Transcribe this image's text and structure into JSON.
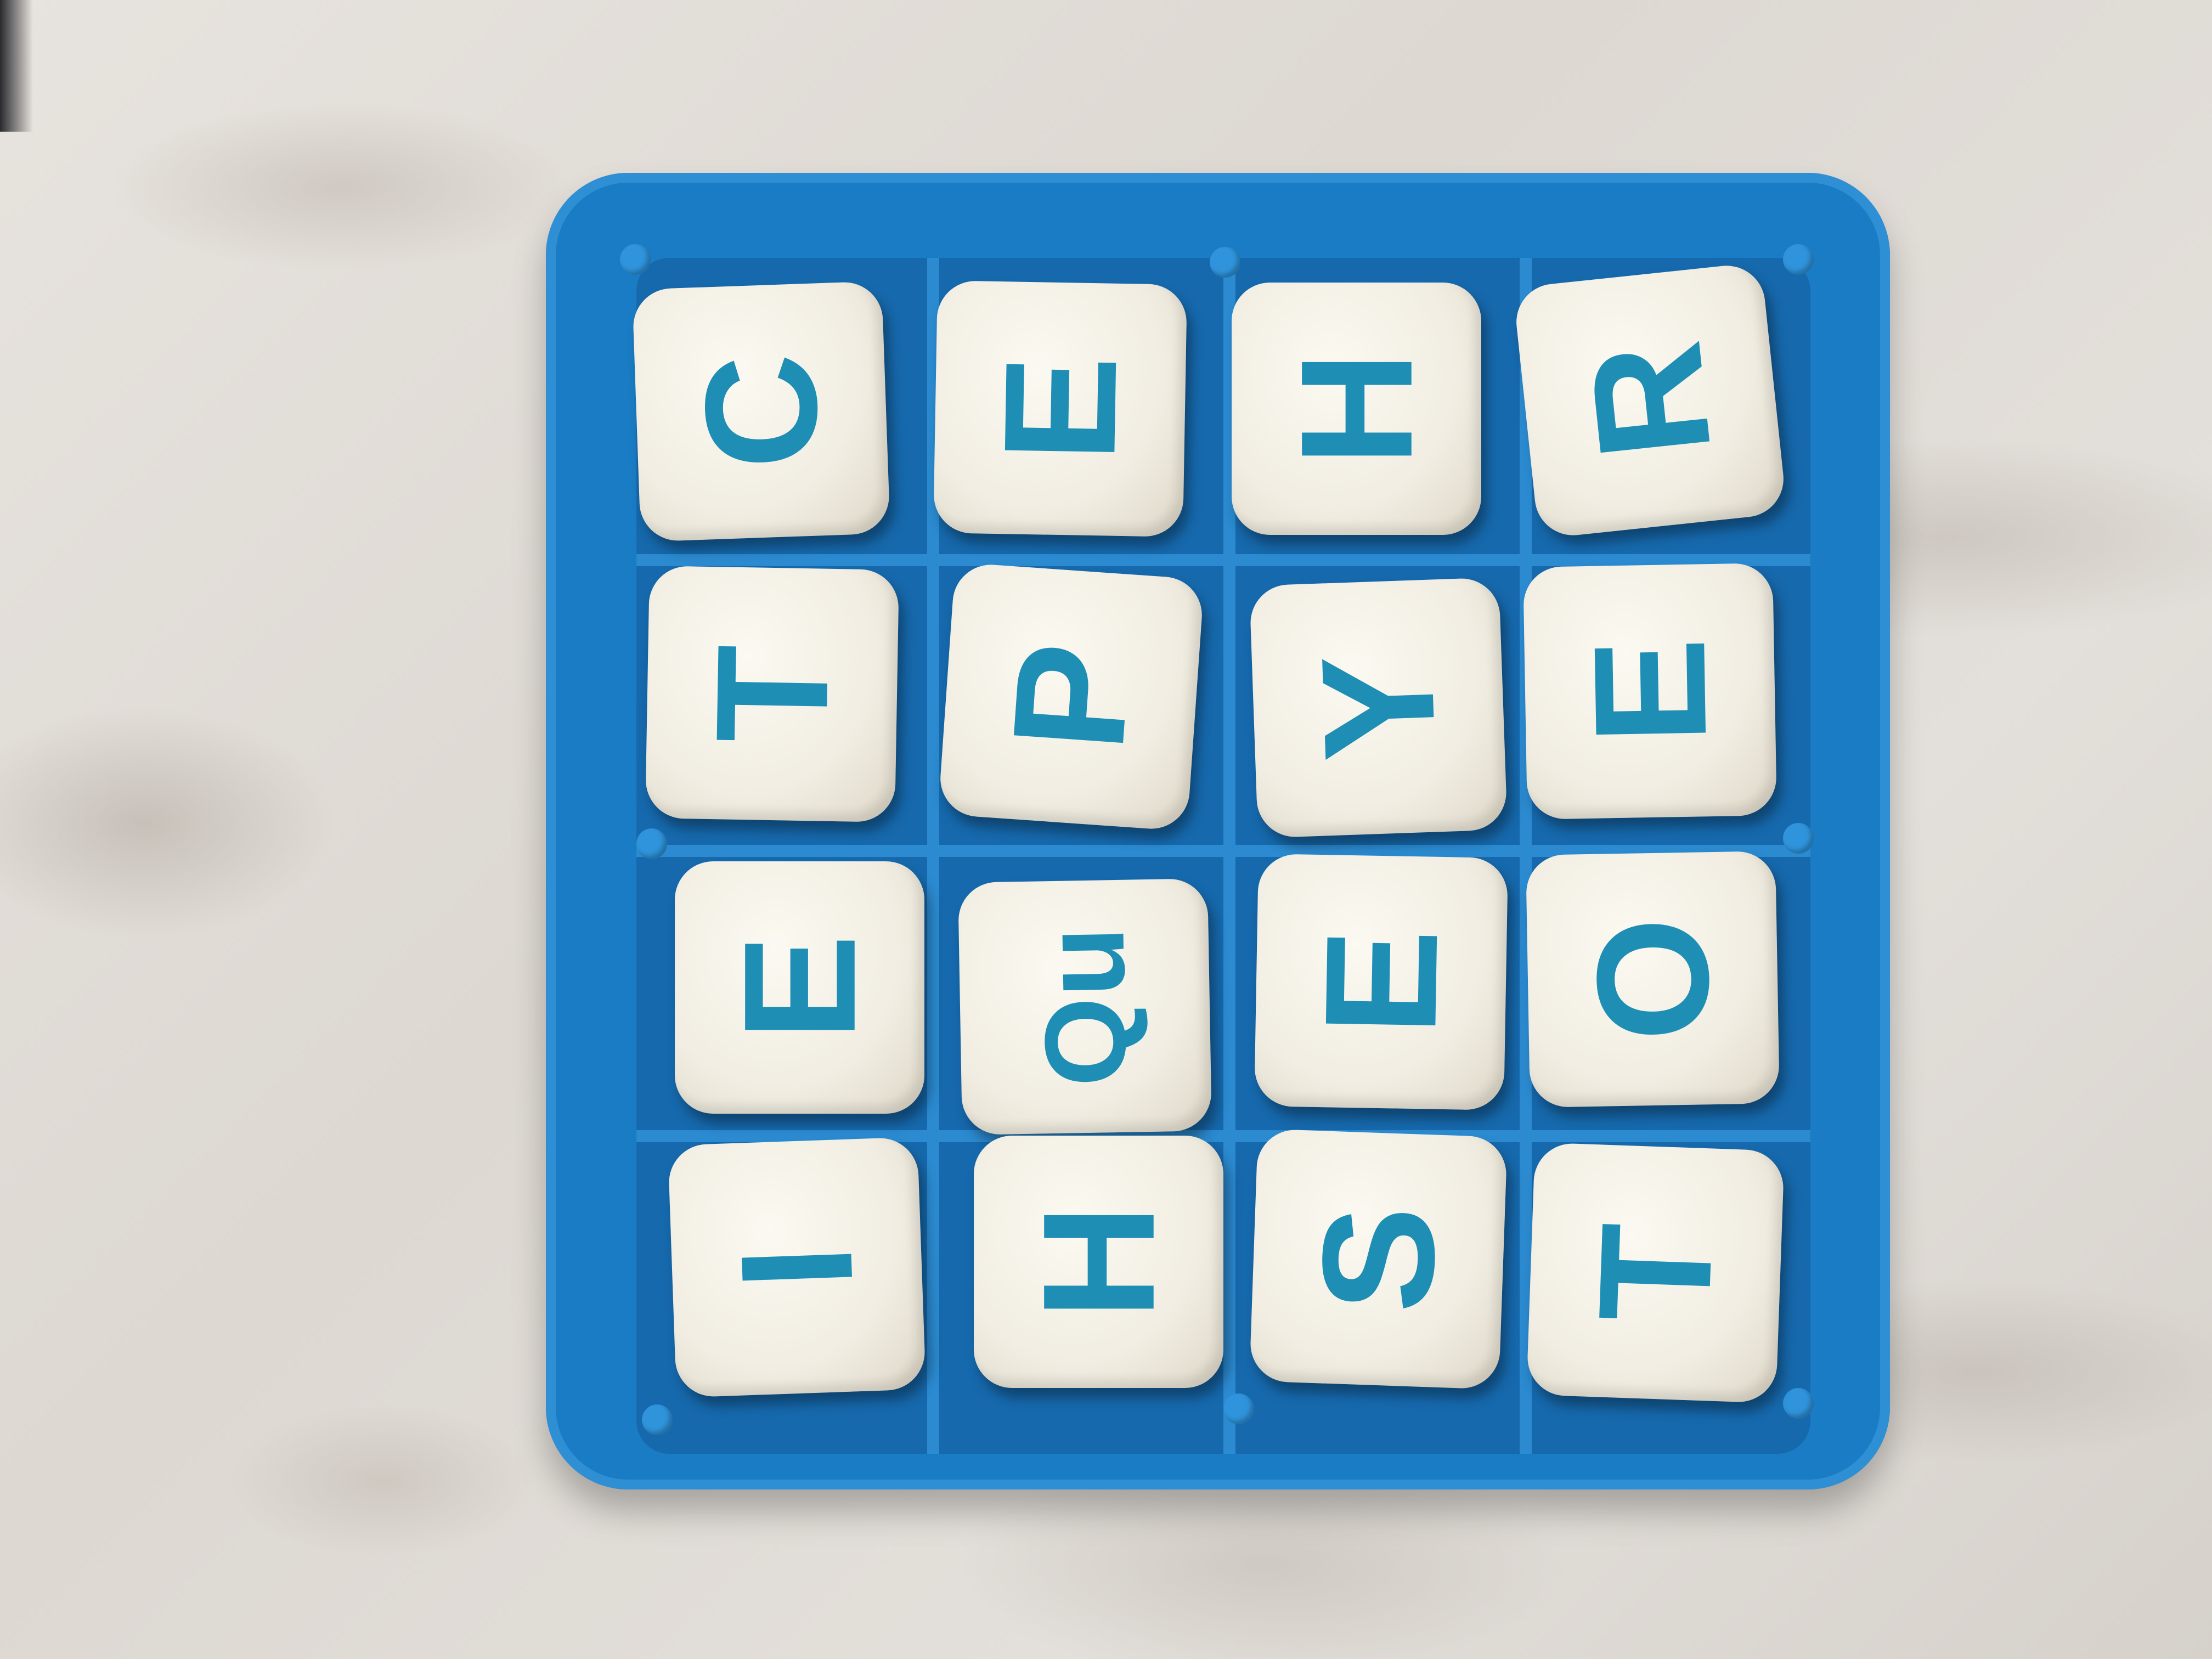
{
  "board": {
    "grid": [
      [
        "C",
        "E",
        "H",
        "R"
      ],
      [
        "T",
        "P",
        "Y",
        "E"
      ],
      [
        "E",
        "Qu",
        "E",
        "O"
      ],
      [
        "I",
        "H",
        "S",
        "T"
      ]
    ]
  },
  "colors": {
    "tray": "#1a7cc4",
    "die_face": "#f4f1e8",
    "letter": "#1e8eb5",
    "table": "#e3dfda"
  }
}
